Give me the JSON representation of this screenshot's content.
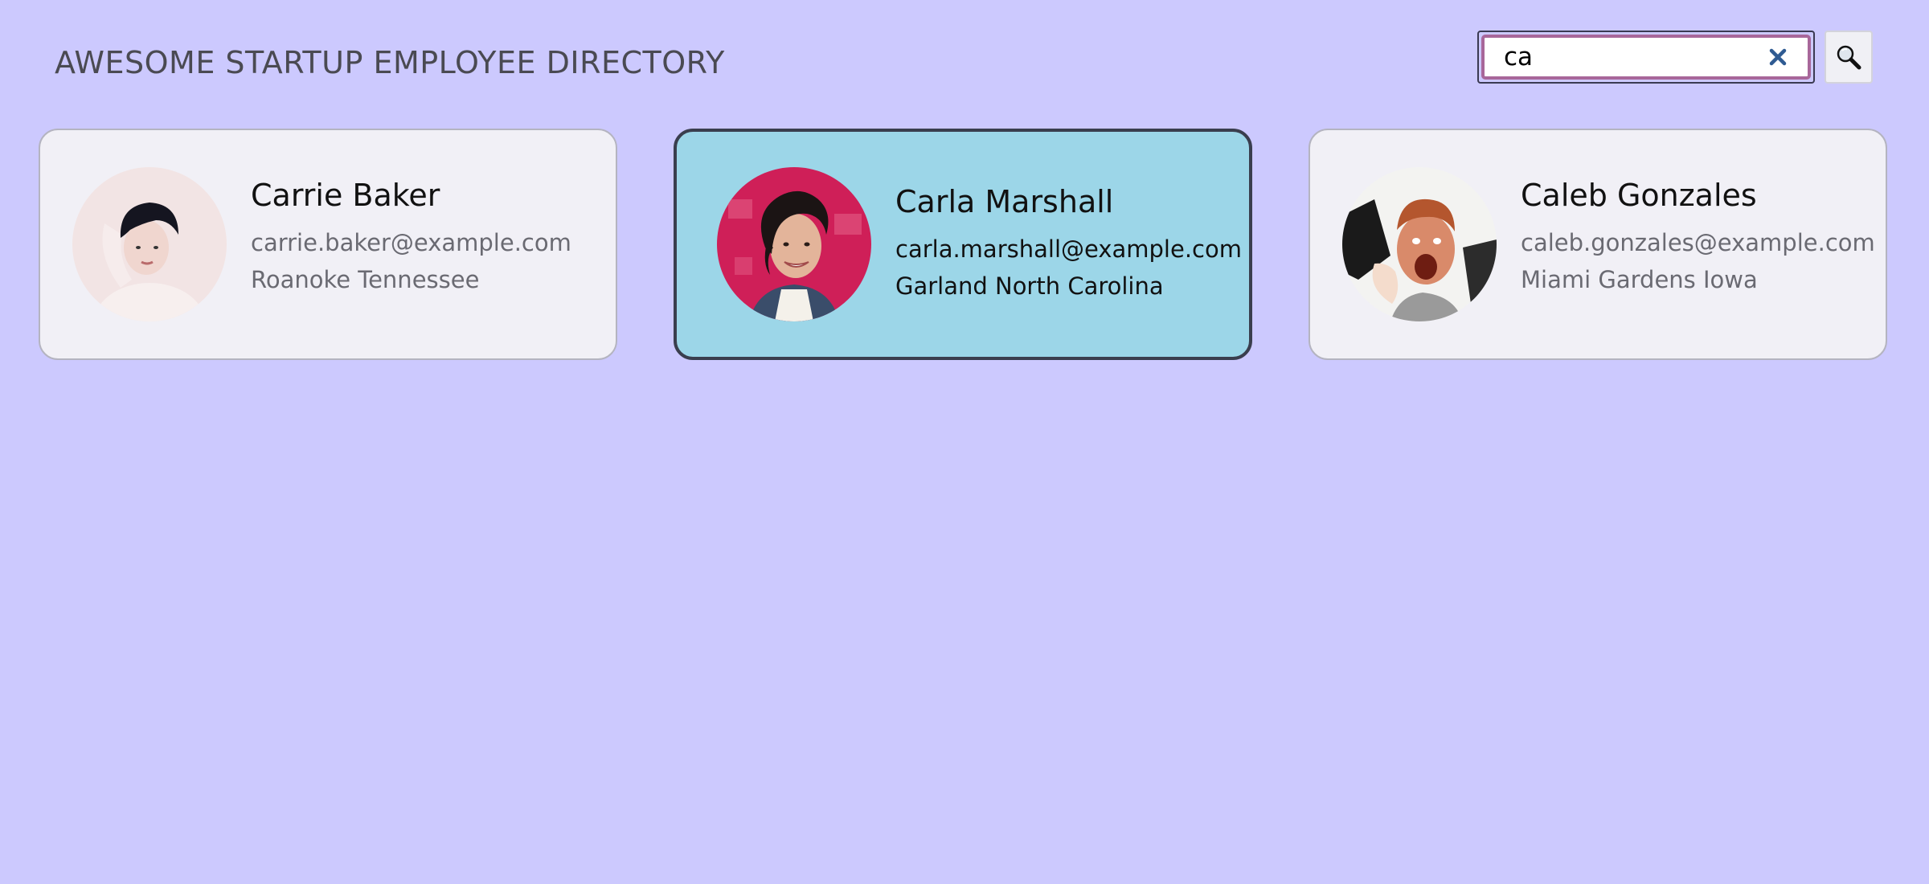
{
  "header": {
    "title": "AWESOME STARTUP EMPLOYEE DIRECTORY"
  },
  "search": {
    "value": "ca",
    "clear_icon": "close-icon",
    "submit_icon": "magnifier-icon"
  },
  "colors": {
    "background": "#ccc9fe",
    "card": "#f1f0f6",
    "card_selected": "#9cd6e8",
    "search_focus_ring": "#a8679a",
    "clear_icon": "#2f5b92"
  },
  "employees": [
    {
      "name": "Carrie Baker",
      "email": "carrie.baker@example.com",
      "location": "Roanoke Tennessee",
      "selected": false
    },
    {
      "name": "Carla Marshall",
      "email": "carla.marshall@example.com",
      "location": "Garland North Carolina",
      "selected": true
    },
    {
      "name": "Caleb Gonzales",
      "email": "caleb.gonzales@example.com",
      "location": "Miami Gardens Iowa",
      "selected": false
    }
  ]
}
